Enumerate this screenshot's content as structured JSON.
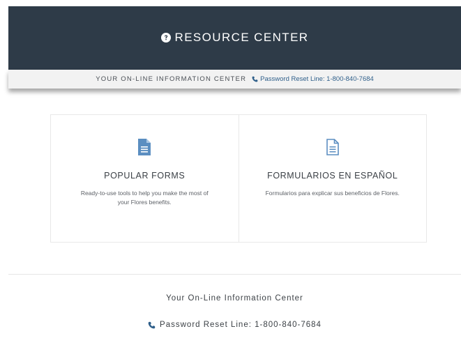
{
  "header": {
    "title": "RESOURCE CENTER",
    "icon": "help-circle-icon"
  },
  "subbar": {
    "text": "YOUR ON-LINE INFORMATION CENTER",
    "phone_label": "Password Reset Line: 1-800-840-7684",
    "phone_icon": "phone-icon"
  },
  "cards": [
    {
      "icon": "document-filled-icon",
      "title": "POPULAR FORMS",
      "description": "Ready-to-use tools to help you make the most of your Flores benefits."
    },
    {
      "icon": "document-outline-icon",
      "title": "FORMULARIOS EN ESPAÑOL",
      "description": "Formularios para explicar sus beneficios de Flores."
    }
  ],
  "footer": {
    "title": "Your On-Line Information Center",
    "phone_label": "Password Reset Line: 1-800-840-7684",
    "phone_icon": "phone-icon"
  },
  "colors": {
    "header_bg": "#2e3b48",
    "link_blue": "#2f5f8a",
    "icon_blue": "#5b8ec1"
  }
}
